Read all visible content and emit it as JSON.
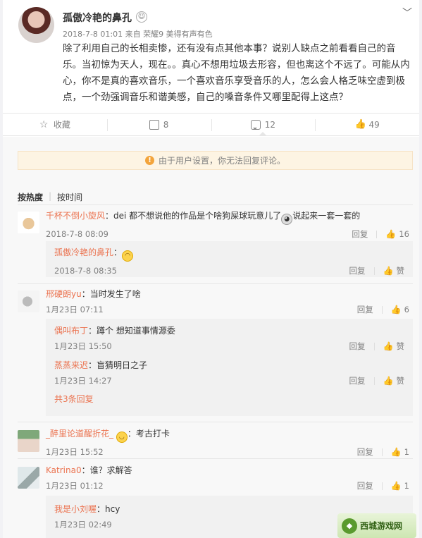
{
  "post": {
    "author": "孤傲冷艳的鼻孔",
    "meta": "2018-7-8 01:01 来自 荣耀9 美得有声有色",
    "text": "除了利用自己的长相卖惨，还有没有点其他本事？说别人缺点之前看看自己的音乐。当初惊为天人，现在。。真心不想用垃圾去形容，但也离这个不远了。可能从内心，你不是真的喜欢音乐，一个喜欢音乐享受音乐的人，怎么会人格乏味空虚到极点，一个劲强调音乐和谐美感，自己的嗓音条件又哪里配得上这点？"
  },
  "actions": {
    "favorite": "收藏",
    "repost": "8",
    "comments": "12",
    "likes": "49"
  },
  "notice": "由于用户设置，你无法回复评论。",
  "sort": {
    "hot": "按热度",
    "time": "按时间"
  },
  "labels": {
    "reply": "回复",
    "like": "赞",
    "more_replies": "共3条回复"
  },
  "comments": [
    {
      "user": "千杯不倒小旋风",
      "text": "dei 都不想说他的作品是个啥狗屎球玩意儿了",
      "text2": "说起来一套一套的",
      "time": "2018-7-8 08:09",
      "likes": "16",
      "replies": [
        {
          "user": "孤傲冷艳的鼻孔",
          "text": "",
          "time": "2018-7-8 08:35"
        }
      ]
    },
    {
      "user": "邢硬朗yu",
      "text": "当时发生了啥",
      "time": "1月23日 07:11",
      "likes": "6",
      "replies": [
        {
          "user": "偶叫布丁",
          "text": "蹲个 想知道事情源委",
          "time": "1月23日 15:50"
        },
        {
          "user": "蒸蒸来迟",
          "text": "盲猜明日之子",
          "time": "1月23日 14:27"
        }
      ]
    },
    {
      "user": "_醉里论道醒折花_",
      "text": "考古打卡",
      "time": "1月23日 15:52",
      "likes": "1"
    },
    {
      "user": "Katrina0",
      "text": "谁？求解答",
      "time": "1月23日 01:12",
      "likes": "1",
      "replies": [
        {
          "user": "我是小刘喔",
          "text": "hcy",
          "time": "1月23日 02:49"
        }
      ]
    }
  ],
  "watermark": "西城游戏网"
}
